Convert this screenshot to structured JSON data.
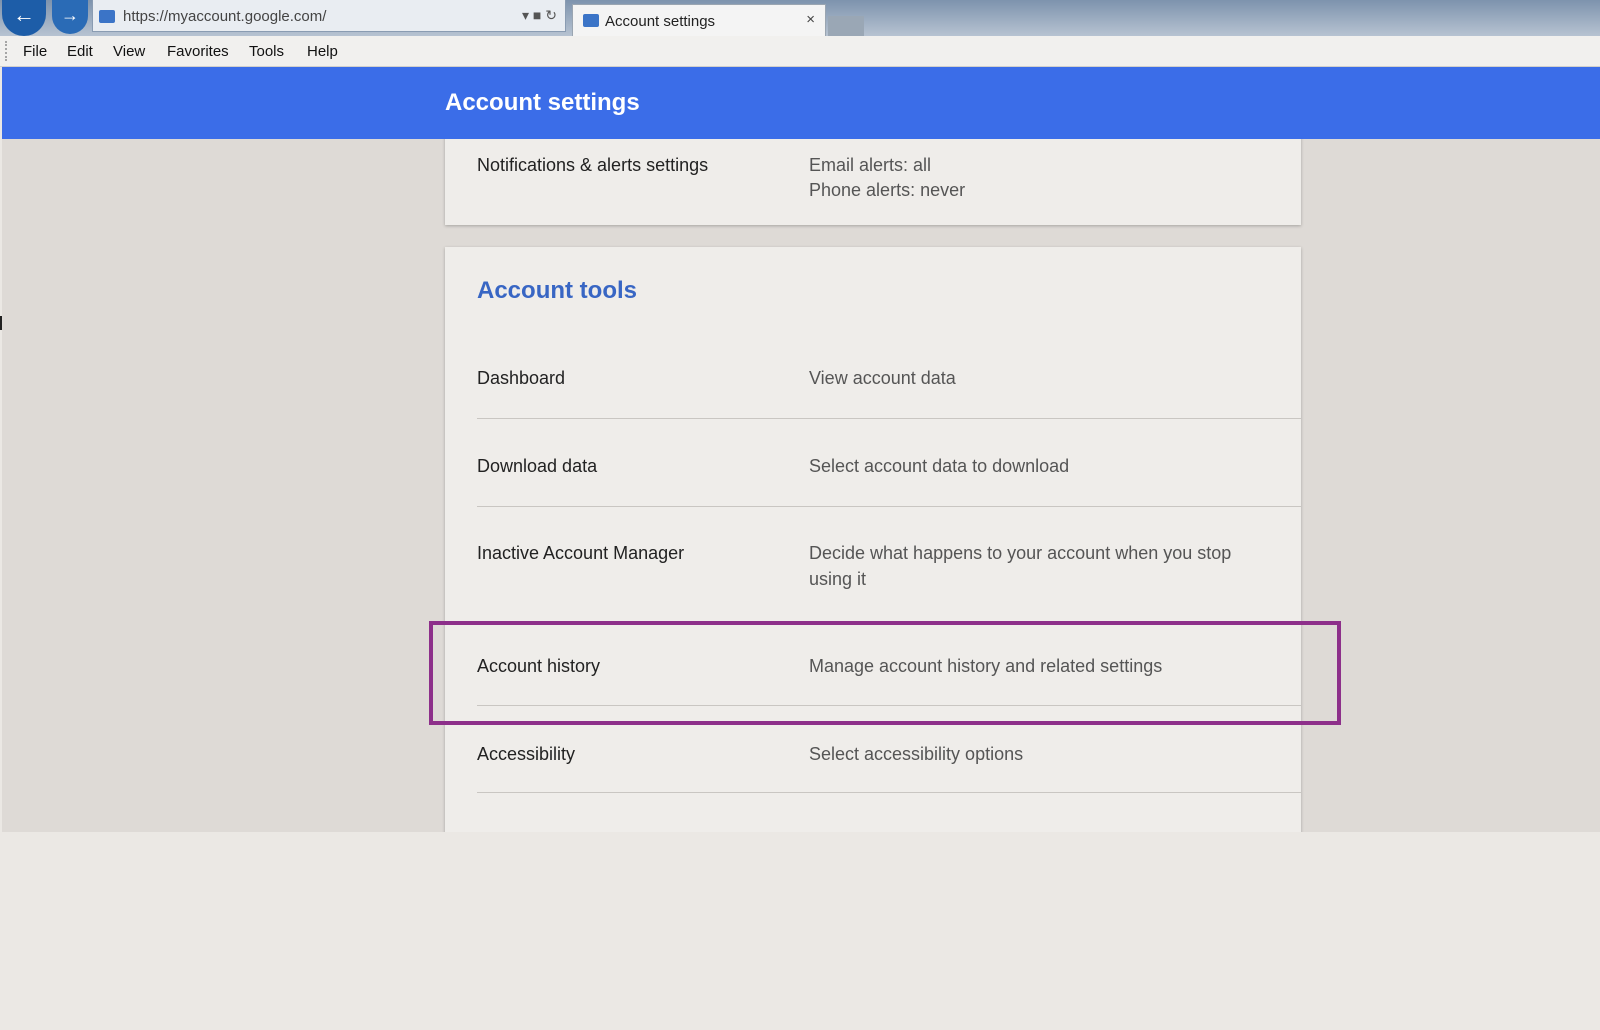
{
  "browser": {
    "address_url": "https://myaccount.google.com/",
    "address_controls": "▾ ■ ↻",
    "tab_title": "Account settings",
    "tab_close": "×",
    "back_glyph": "←",
    "forward_glyph": "→"
  },
  "menu": {
    "items": [
      "File",
      "Edit",
      "View",
      "Favorites",
      "Tools",
      "Help"
    ]
  },
  "header": {
    "title": "Account settings",
    "color": "#3b6de8"
  },
  "notifications": {
    "label": "Notifications & alerts settings",
    "value_line1": "Email alerts: all",
    "value_line2": "Phone alerts: never"
  },
  "account_tools": {
    "heading": "Account tools",
    "rows": [
      {
        "label": "Dashboard",
        "value": "View account data"
      },
      {
        "label": "Download data",
        "value": "Select account data to download"
      },
      {
        "label": "Inactive Account Manager",
        "value_line1": "Decide what happens to your account when you stop",
        "value_line2": "using it"
      },
      {
        "label": "Account history",
        "value": "Manage account history and related settings"
      },
      {
        "label": "Accessibility",
        "value": "Select accessibility options"
      }
    ]
  },
  "annotation": {
    "highlight_color": "#8d2f8a"
  },
  "icons": {
    "back": "back-arrow-icon",
    "forward": "forward-arrow-icon",
    "site": "site-icon",
    "close": "close-icon"
  }
}
